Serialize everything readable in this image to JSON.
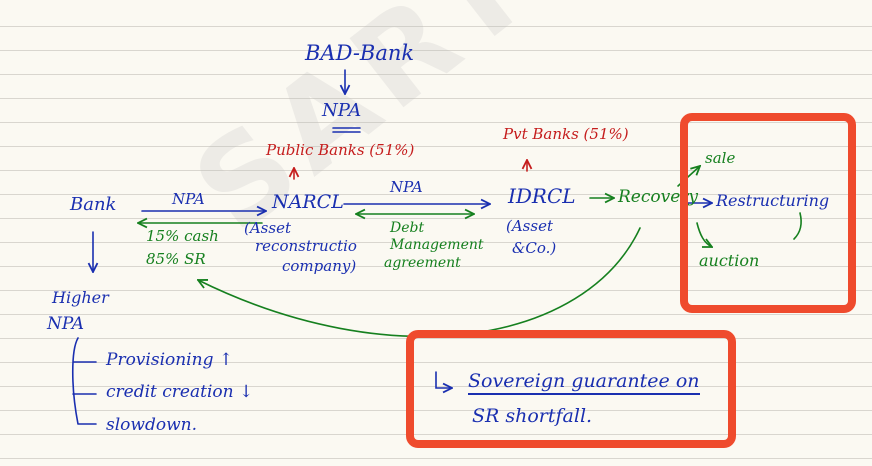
{
  "watermark": "SARTHI",
  "bad_bank": {
    "title": "BAD-Bank",
    "npa": "NPA",
    "public_banks": "Public Banks (51%)"
  },
  "bank": {
    "label": "Bank",
    "npa_arrow_label": "NPA",
    "cash": "15% cash",
    "sr": "85% SR"
  },
  "narcl": {
    "label": "NARCL",
    "desc_line1": "(Asset",
    "desc_line2": "reconstructio",
    "desc_line3": "company)"
  },
  "middle": {
    "npa_arrow_label": "NPA",
    "debt_line1": "Debt",
    "debt_line2": "Management",
    "debt_line3": "agreement"
  },
  "idrcl": {
    "label": "IDRCL",
    "pvt_banks": "Pvt Banks (51%)",
    "desc_line1": "(Asset",
    "desc_line2": "&Co.)"
  },
  "recovery": {
    "label": "Recovery",
    "options": [
      "sale",
      "Restructuring",
      "auction"
    ]
  },
  "higher_npa": {
    "line1": "Higher",
    "line2": "NPA",
    "effects": [
      "Provisioning ↑",
      "credit creation ↓",
      "slowdown."
    ]
  },
  "guarantee": {
    "line1": "Sovereign guarantee on",
    "line2": "SR shortfall."
  },
  "colors": {
    "blue_ink": "#1a2fb0",
    "green_ink": "#16801f",
    "red_ink": "#c51d1d",
    "highlight_box": "#ef4b2d"
  }
}
